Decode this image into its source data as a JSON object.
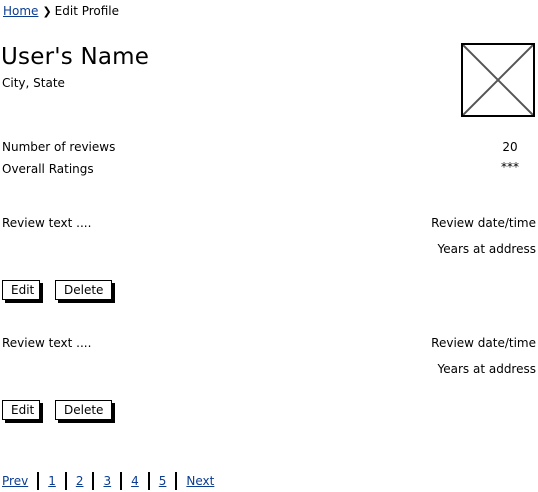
{
  "breadcrumb": {
    "home": "Home",
    "separator": "❯",
    "current": "Edit Profile"
  },
  "profile": {
    "name": "User's Name",
    "location": "City, State",
    "avatar": "image-placeholder-icon"
  },
  "stats": {
    "reviews_label": "Number of reviews",
    "reviews_value": "20",
    "ratings_label": "Overall Ratings",
    "ratings_value": "***"
  },
  "reviews": [
    {
      "text": "Review text ....",
      "date": "Review date/time",
      "years": "Years at address",
      "edit_label": "Edit",
      "delete_label": "Delete"
    },
    {
      "text": "Review text ....",
      "date": "Review date/time",
      "years": "Years at address",
      "edit_label": "Edit",
      "delete_label": "Delete"
    }
  ],
  "pagination": {
    "prev": "Prev",
    "pages": [
      "1",
      "2",
      "3",
      "4",
      "5"
    ],
    "next": "Next"
  },
  "colors": {
    "link": "#0b3d91",
    "text": "#000000",
    "background": "#ffffff"
  }
}
